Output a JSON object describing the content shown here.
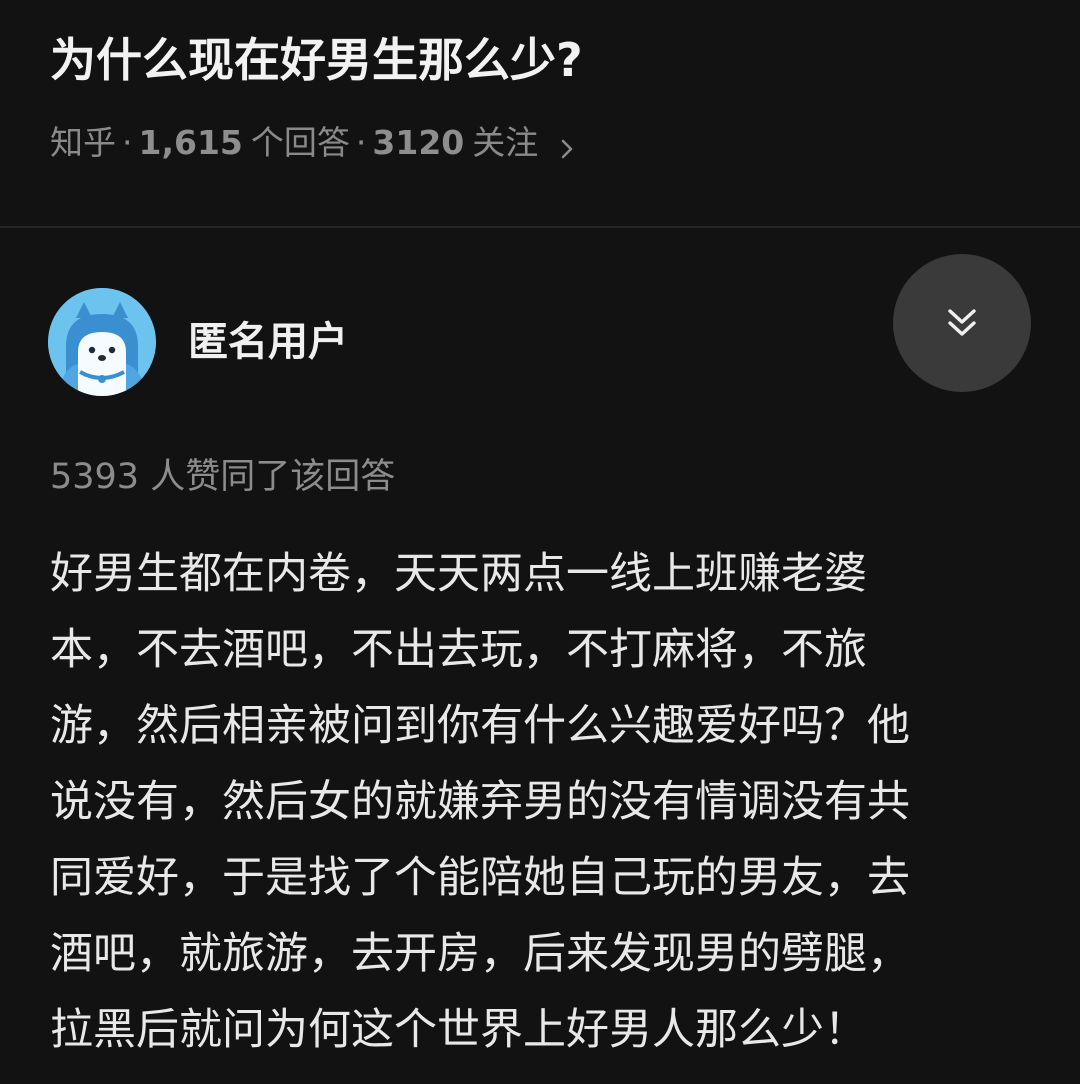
{
  "question": {
    "title": "为什么现在好男生那么少?",
    "source": "知乎",
    "answers_count": "1,615",
    "answers_suffix": "个回答",
    "follows_count": "3120",
    "follows_suffix": "关注"
  },
  "answer": {
    "author_name": "匿名用户",
    "upvotes_text": "5393 人赞同了该回答",
    "lines": [
      "好男生都在内卷，天天两点一线上班赚老婆",
      "本，不去酒吧，不出去玩，不打麻将，不旅",
      "游，然后相亲被问到你有什么兴趣爱好吗？他",
      "说没有，然后女的就嫌弃男的没有情调没有共",
      "同爱好，于是找了个能陪她自己玩的男友，去",
      "酒吧，就旅游，去开房，后来发现男的劈腿，",
      "拉黑后就问为何这个世界上好男人那么少！"
    ]
  },
  "icons": {
    "meta_chevron": "chevron-right-icon",
    "collapse": "double-chevron-down-icon",
    "avatar": "anonymous-user-avatar"
  },
  "colors": {
    "background": "#121212",
    "primary_text": "#ebebeb",
    "secondary_text": "#8a8a8a",
    "button_bg": "#3a3a3a",
    "avatar_blue": "#6cc3ee"
  }
}
